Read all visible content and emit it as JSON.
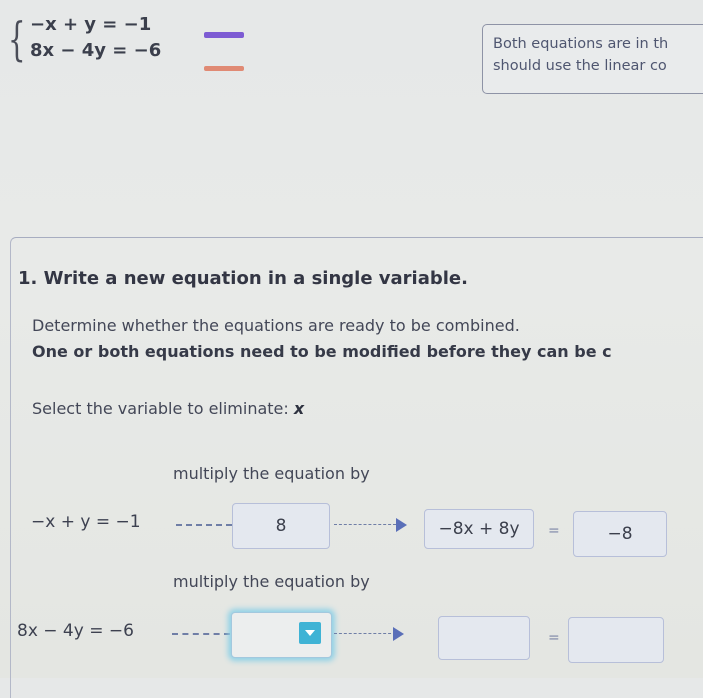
{
  "system": {
    "equation_1": "−x + y = −1",
    "equation_2": "8x − 4y = −6",
    "equation_1_color": "#7d5bd3",
    "equation_2_color": "#e08a74"
  },
  "hint": {
    "line_1": "Both equations are in th",
    "line_2": "should use the linear co"
  },
  "step": {
    "title": "1. Write a new equation in a single variable.",
    "instruction": "Determine whether the equations are ready to be combined.",
    "status": "One or both equations need to be modified before they can be c",
    "select_label": "Select the variable to eliminate:",
    "selected_variable": "x"
  },
  "rows": [
    {
      "label": "multiply the equation by",
      "equation": "−x + y = −1",
      "multiplier": "8",
      "result_left": "−8x + 8y",
      "equals": "=",
      "result_right": "−8"
    },
    {
      "label": "multiply the equation by",
      "equation": "8x − 4y = −6",
      "multiplier": "",
      "result_left": "",
      "equals": "=",
      "result_right": ""
    }
  ],
  "icons": {
    "dropdown": "chevron-down-icon",
    "arrow": "arrow-right-icon"
  }
}
